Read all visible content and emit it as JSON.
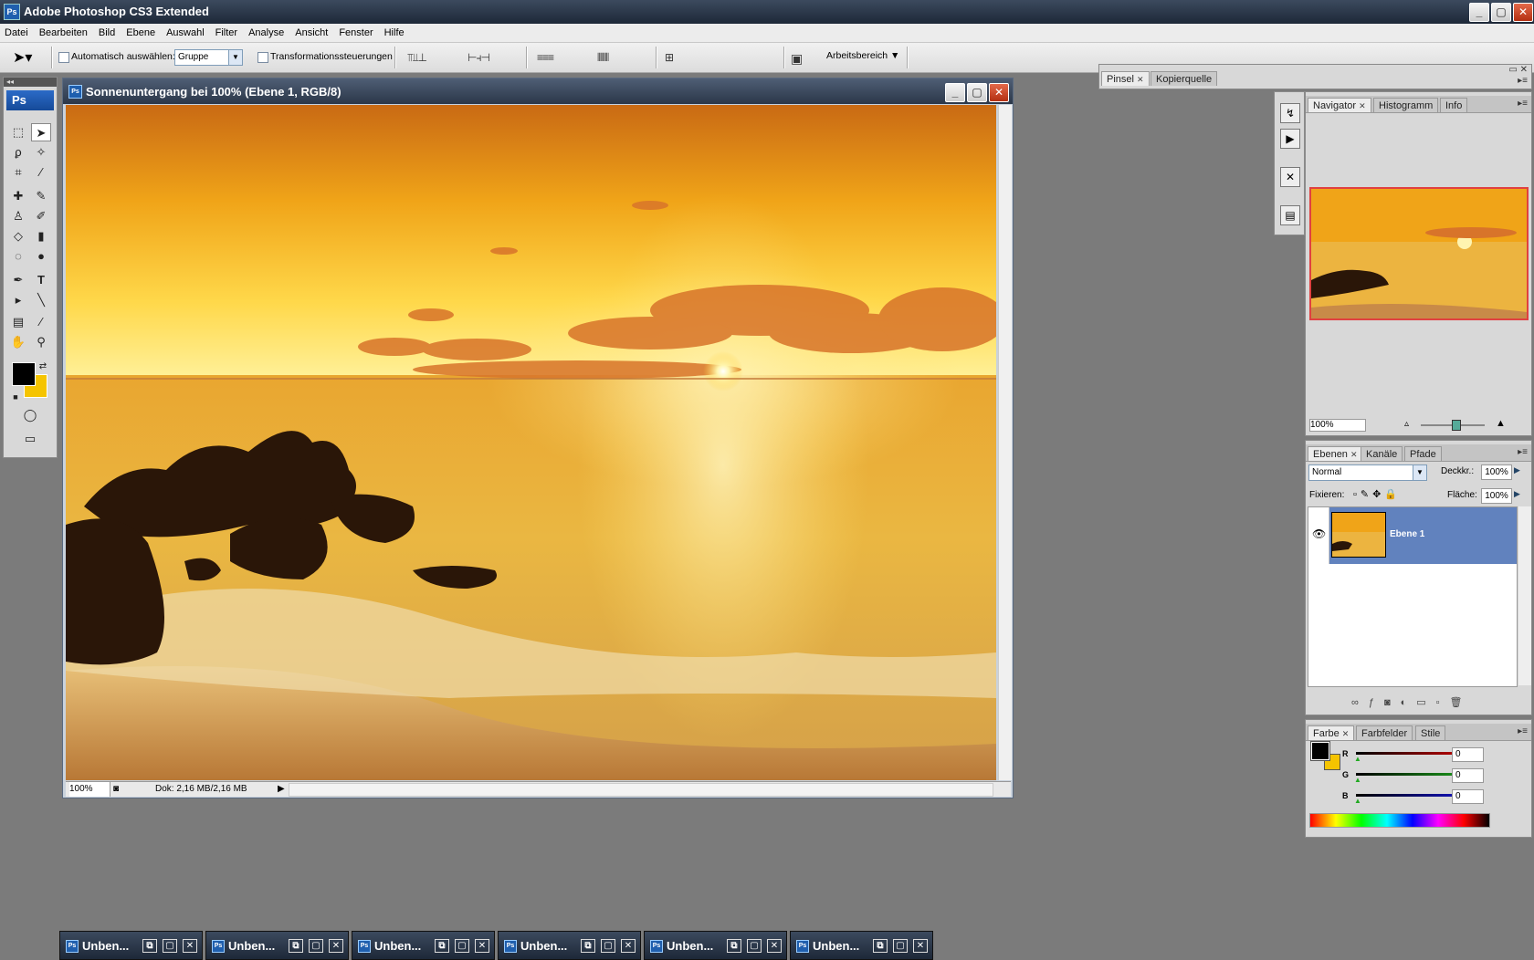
{
  "app": {
    "title": "Adobe Photoshop CS3 Extended",
    "icon_label": "Ps",
    "window_buttons": [
      "_",
      "▢",
      "✕"
    ]
  },
  "menu": [
    "Datei",
    "Bearbeiten",
    "Bild",
    "Ebene",
    "Auswahl",
    "Filter",
    "Analyse",
    "Ansicht",
    "Fenster",
    "Hilfe"
  ],
  "options": {
    "auto_select_label": "Automatisch auswählen:",
    "auto_select_value": "Gruppe",
    "transform_label": "Transformationssteuerungen",
    "workspace_label": "Arbeitsbereich"
  },
  "toolbox": {
    "logo": "Ps"
  },
  "document": {
    "title": "Sonnenuntergang bei 100% (Ebene 1, RGB/8)",
    "zoom": "100%",
    "doc_info": "Dok: 2,16 MB/2,16 MB"
  },
  "brush_panel": {
    "tabs": [
      "Pinsel",
      "Kopierquelle"
    ]
  },
  "navigator": {
    "tabs": [
      "Navigator",
      "Histogramm",
      "Info"
    ],
    "zoom": "100%"
  },
  "layers": {
    "tabs": [
      "Ebenen",
      "Kanäle",
      "Pfade"
    ],
    "blend_mode": "Normal",
    "opacity_label": "Deckkr.:",
    "opacity_value": "100%",
    "lock_label": "Fixieren:",
    "fill_label": "Fläche:",
    "fill_value": "100%",
    "layer_name": "Ebene 1"
  },
  "color": {
    "tabs": [
      "Farbe",
      "Farbfelder",
      "Stile"
    ],
    "channels": [
      {
        "label": "R",
        "value": "0",
        "color": "#d40000"
      },
      {
        "label": "G",
        "value": "0",
        "color": "#1ea81e"
      },
      {
        "label": "B",
        "value": "0",
        "color": "#1414d4"
      }
    ],
    "foreground": "#000000",
    "background": "#f5c400"
  },
  "minimized_windows": [
    {
      "label": "Unben..."
    },
    {
      "label": "Unben..."
    },
    {
      "label": "Unben..."
    },
    {
      "label": "Unben..."
    },
    {
      "label": "Unben..."
    },
    {
      "label": "Unben..."
    }
  ]
}
